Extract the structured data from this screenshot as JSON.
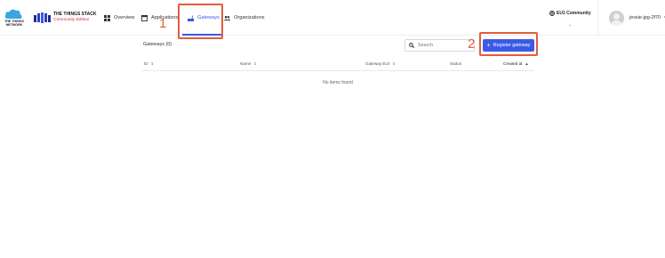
{
  "brand": {
    "ttn_logo_text": "THE THINGS NETWORK",
    "stack_name": "THE THINGS STACK",
    "stack_edition": "Community Edition"
  },
  "nav": {
    "overview": "Overview",
    "applications": "Applications",
    "gateways": "Gateways",
    "organizations": "Organizations",
    "active": "gateways"
  },
  "callouts": {
    "step1": "1",
    "step2": "2",
    "color": "#e25c3c"
  },
  "network": {
    "label": "EU1 Community",
    "dropdown_icon": "chevron-down-icon"
  },
  "user": {
    "name": "jessie-jpg-2f70",
    "avatar_icon": "user-avatar-icon"
  },
  "toolbar": {
    "title": "Gateways (0)",
    "search_placeholder": "Search",
    "register_label": "Register gateway"
  },
  "table": {
    "columns": [
      "ID",
      "Name",
      "Gateway EUI",
      "Status",
      "Created at"
    ],
    "sorted_column": "Created at",
    "sort_direction": "asc",
    "empty_message": "No items found"
  },
  "colors": {
    "accent": "#3c5ae6",
    "brand_red": "#d42a3a",
    "cloud_blue": "#3aa6e0"
  }
}
